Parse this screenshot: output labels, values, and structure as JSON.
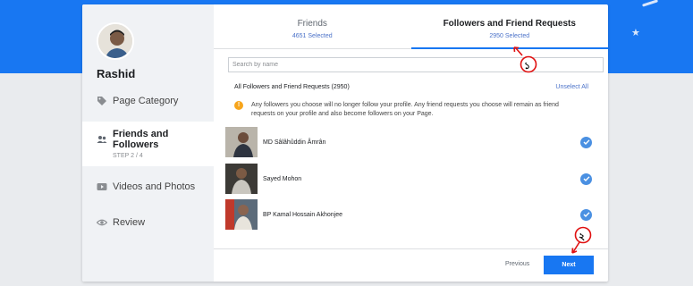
{
  "sidebar": {
    "username": "Rashid",
    "items": [
      {
        "label": "Page Category",
        "icon": "tag-icon"
      },
      {
        "label": "Friends and Followers",
        "icon": "people-icon",
        "step": "STEP 2 / 4"
      },
      {
        "label": "Videos and Photos",
        "icon": "video-icon"
      },
      {
        "label": "Review",
        "icon": "eye-icon"
      }
    ]
  },
  "tabs": [
    {
      "label": "Friends",
      "count": "4651 Selected"
    },
    {
      "label": "Followers and Friend Requests",
      "count": "2950 Selected"
    }
  ],
  "search": {
    "placeholder": "Search by name"
  },
  "list": {
    "title": "All Followers and Friend Requests (2950)",
    "unselect_all": "Unselect All",
    "notice": "Any followers you choose will no longer follow your profile. Any friend requests you choose will remain as friend requests on your profile and also become followers on your Page.",
    "people": [
      {
        "name": "MD Sâlâhûddin Âmrân",
        "checked": true
      },
      {
        "name": "Sayed Mohon",
        "checked": true
      },
      {
        "name": "BP Kamal Hossain Akhonjee",
        "checked": true
      }
    ]
  },
  "footer": {
    "previous": "Previous",
    "next": "Next"
  },
  "annotations": [
    "১",
    "২"
  ],
  "colors": {
    "primary": "#1877f2",
    "check": "#4a90e2",
    "warning": "#f7a51c",
    "annotation": "#e01010"
  }
}
